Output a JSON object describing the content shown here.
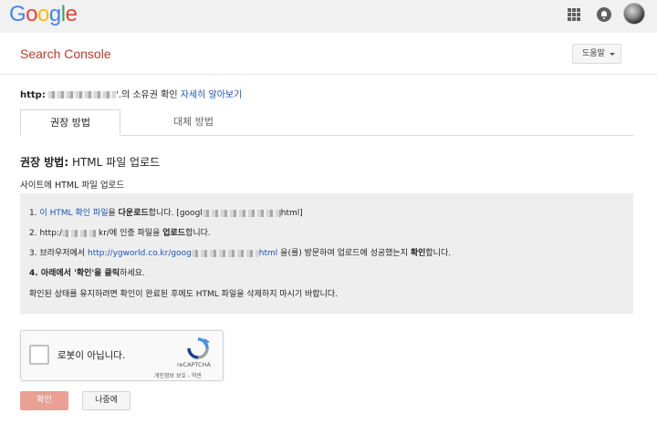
{
  "topbar": {
    "logo_letters": [
      "G",
      "o",
      "o",
      "g",
      "l",
      "e"
    ],
    "icons": [
      "apps-grid-icon",
      "notifications-icon",
      "account-avatar"
    ]
  },
  "header": {
    "title": "Search Console",
    "help_label": "도움말"
  },
  "ownership": {
    "prefix": "http:",
    "suffix": "'.의 소유권 확인",
    "link": "자세히 알아보기"
  },
  "tabs": [
    {
      "label": "권장 방법",
      "active": true
    },
    {
      "label": "대체 방법",
      "active": false
    }
  ],
  "method": {
    "title_bold": "권장 방법:",
    "title_rest": " HTML 파일 업로드",
    "subtitle": "사이트에 HTML 파일 업로드"
  },
  "steps": {
    "s1_num": "1. ",
    "s1_link": "이 HTML 확인 파일",
    "s1_text1": "을 ",
    "s1_bold": "다운로드",
    "s1_text2": "합니다. [googl",
    "s1_tail": "html]",
    "s2_text1": "2. http:/",
    "s2_text2": "kr/에 인증 파일을 ",
    "s2_bold": "업로드",
    "s2_text3": "합니다.",
    "s3_text1": "3. 브라우저에서 ",
    "s3_link": "http://ygworld.co.kr/goog",
    "s3_link_tail": "html",
    "s3_text2": " 을(를) 방문하여 업로드에 성공했는지 ",
    "s3_bold": "확인",
    "s3_text3": "합니다.",
    "s4_bold": "4. 아래에서 '확인'을 클릭",
    "s4_text": "하세요.",
    "s5_text": "확인된 상태를 유지하려면 확인이 완료된 후에도 HTML 파일을 삭제하지 마시기 바랍니다."
  },
  "captcha": {
    "label": "로봇이 아닙니다.",
    "brand": "reCAPTCHA",
    "links": "개인정보 보호 - 약관"
  },
  "buttons": {
    "confirm": "확인",
    "later": "나중에"
  },
  "colors": {
    "title_red": "#c0392b",
    "link_blue": "#1a55b8",
    "confirm_bg": "#e8a193"
  }
}
